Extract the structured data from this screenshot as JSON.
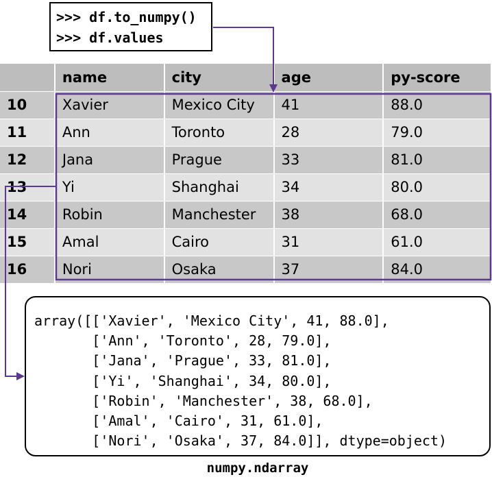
{
  "code": {
    "lines": [
      ">>> df.to_numpy()",
      ">>> df.values"
    ]
  },
  "table": {
    "columns": [
      "",
      "name",
      "city",
      "age",
      "py-score"
    ],
    "rows": [
      {
        "index": "10",
        "name": "Xavier",
        "city": "Mexico City",
        "age": "41",
        "score": "88.0"
      },
      {
        "index": "11",
        "name": "Ann",
        "city": "Toronto",
        "age": "28",
        "score": "79.0"
      },
      {
        "index": "12",
        "name": "Jana",
        "city": "Prague",
        "age": "33",
        "score": "81.0"
      },
      {
        "index": "13",
        "name": "Yi",
        "city": "Shanghai",
        "age": "34",
        "score": "80.0"
      },
      {
        "index": "14",
        "name": "Robin",
        "city": "Manchester",
        "age": "38",
        "score": "68.0"
      },
      {
        "index": "15",
        "name": "Amal",
        "city": "Cairo",
        "age": "31",
        "score": "61.0"
      },
      {
        "index": "16",
        "name": "Nori",
        "city": "Osaka",
        "age": "37",
        "score": "84.0"
      }
    ]
  },
  "array": {
    "lines": [
      "array([['Xavier', 'Mexico City', 41, 88.0],",
      "       ['Ann', 'Toronto', 28, 79.0],",
      "       ['Jana', 'Prague', 33, 81.0],",
      "       ['Yi', 'Shanghai', 34, 80.0],",
      "       ['Robin', 'Manchester', 38, 68.0],",
      "       ['Amal', 'Cairo', 31, 61.0],",
      "       ['Nori', 'Osaka', 37, 84.0]], dtype=object)"
    ]
  },
  "caption": "numpy.ndarray",
  "colors": {
    "highlight": "#5b3a8e",
    "header_bg": "#bdbdbd",
    "row_dark": "#c8c8c8",
    "row_light": "#e2e2e2"
  }
}
